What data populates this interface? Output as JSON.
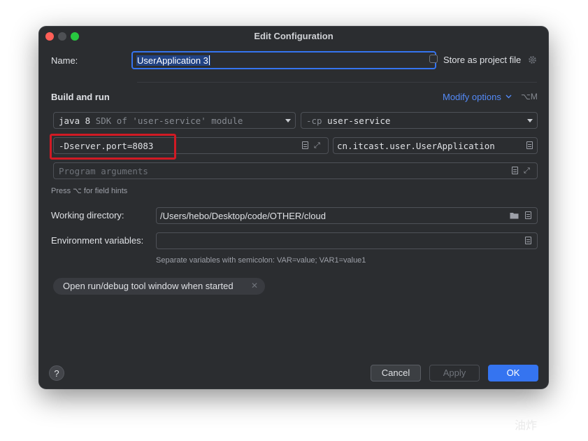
{
  "window": {
    "title": "Edit Configuration"
  },
  "name_row": {
    "label": "Name:",
    "value": "UserApplication 3",
    "store_label": "Store as project file",
    "store_checked": false
  },
  "build_and_run": {
    "section_title": "Build and run",
    "modify_options_label": "Modify options",
    "modify_shortcut": "⌥M",
    "jdk": {
      "java_version": "java 8",
      "sdk_hint": "SDK of 'user-service' module"
    },
    "classpath": {
      "flag": "-cp",
      "module": "user-service"
    },
    "vm_options": "-Dserver.port=8083",
    "main_class": "cn.itcast.user.UserApplication",
    "program_args_placeholder": "Program arguments",
    "field_hint": "Press ⌥ for field hints"
  },
  "working_directory": {
    "label": "Working directory:",
    "value": "/Users/hebo/Desktop/code/OTHER/cloud"
  },
  "environment": {
    "label": "Environment variables:",
    "value": "",
    "hint": "Separate variables with semicolon: VAR=value; VAR1=value1"
  },
  "options": {
    "chip_label": "Open run/debug tool window when started"
  },
  "footer": {
    "help": "?",
    "cancel": "Cancel",
    "apply": "Apply",
    "ok": "OK"
  },
  "colors": {
    "background": "#2b2d30",
    "accent": "#3574f0",
    "link": "#548af7",
    "highlight_box": "#d11a24"
  },
  "watermark": "油炸"
}
